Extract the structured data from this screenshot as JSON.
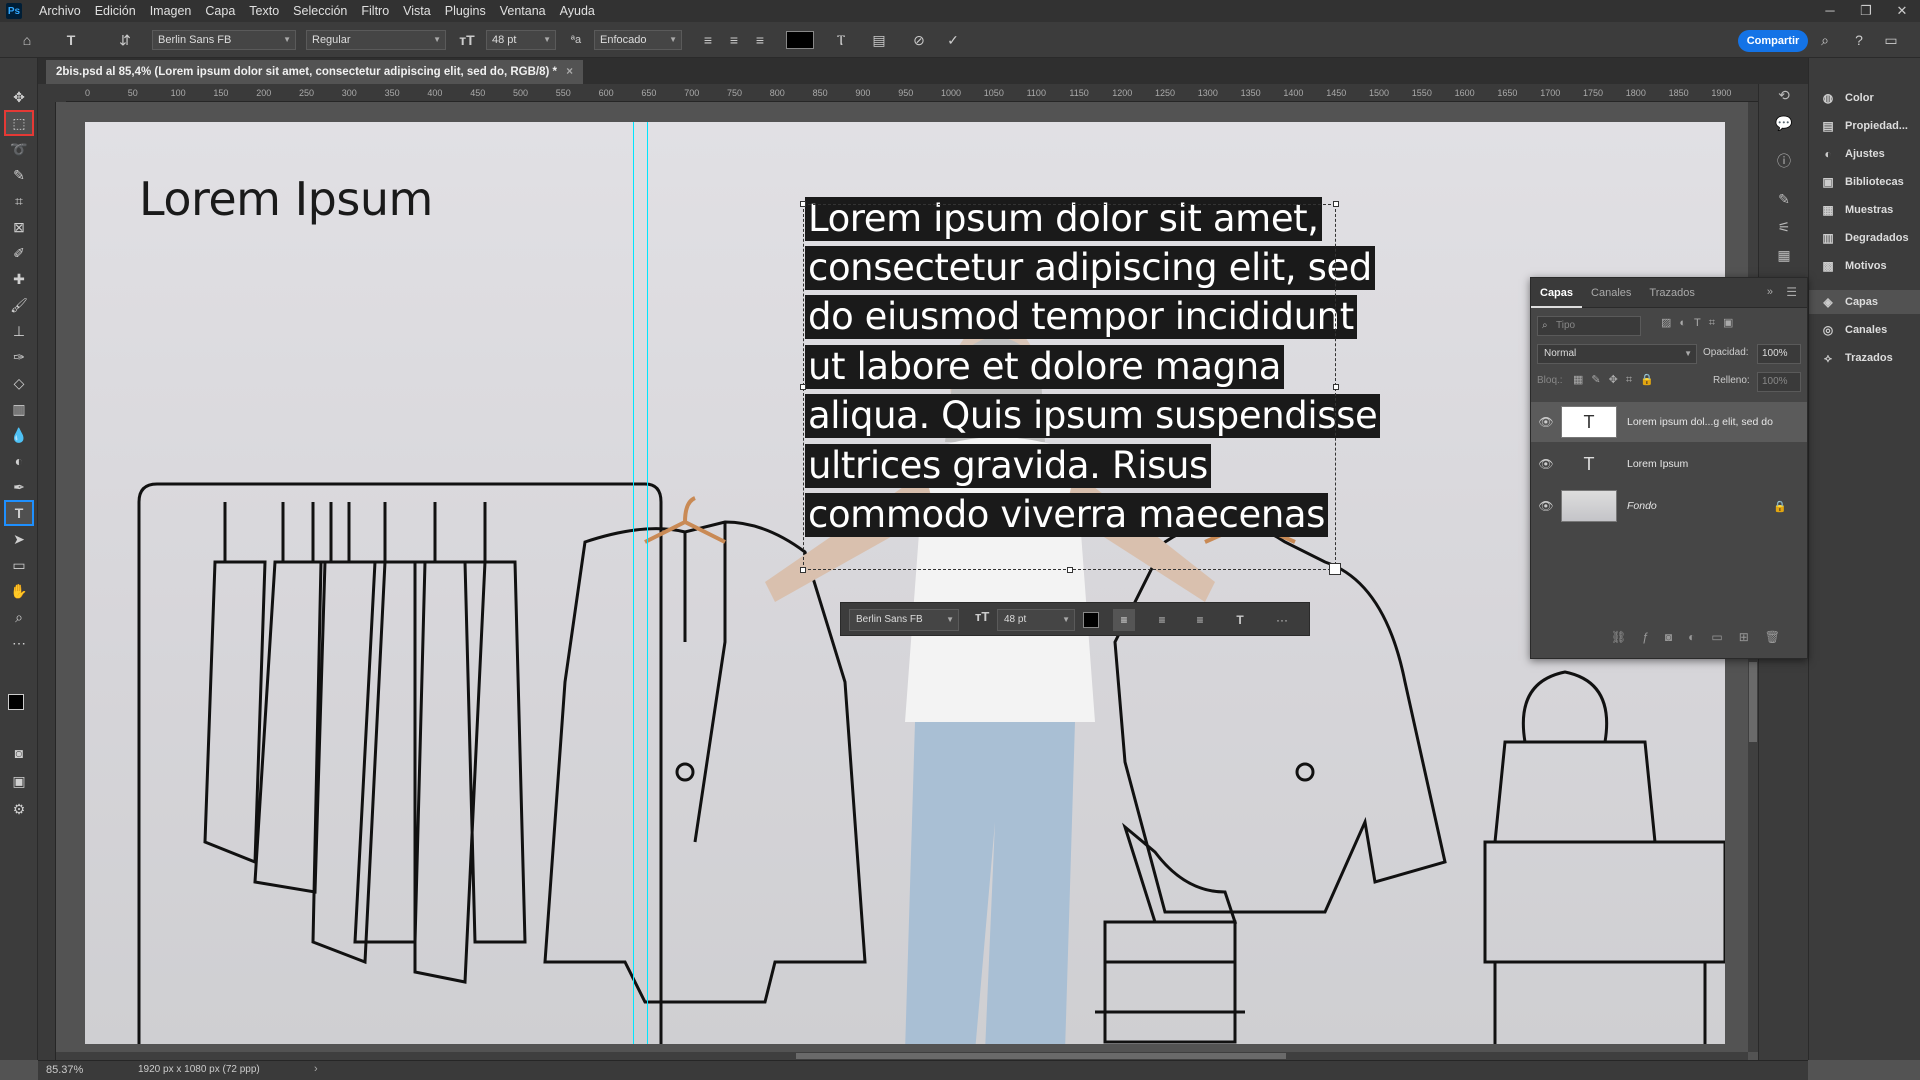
{
  "menubar": {
    "logo": "Ps",
    "items": [
      "Archivo",
      "Edición",
      "Imagen",
      "Capa",
      "Texto",
      "Selección",
      "Filtro",
      "Vista",
      "Plugins",
      "Ventana",
      "Ayuda"
    ]
  },
  "options": {
    "font_family": "Berlin Sans FB",
    "font_style": "Regular",
    "font_size": "48 pt",
    "antialias": "Enfocado",
    "text_color": "#000000",
    "share_label": "Compartir"
  },
  "document": {
    "tab_title": "2bis.psd al 85,4% (Lorem ipsum dolor sit amet, consectetur adipiscing elit, sed do, RGB/8) *",
    "close": "×"
  },
  "ruler": {
    "ticks": [
      "0",
      "50",
      "100",
      "150",
      "200",
      "250",
      "300",
      "350",
      "400",
      "450",
      "500",
      "550",
      "600",
      "650",
      "700",
      "750",
      "800",
      "850",
      "900",
      "950",
      "1000",
      "1050",
      "1100",
      "1150",
      "1200",
      "1250",
      "1300",
      "1350",
      "1400",
      "1450",
      "1500",
      "1550",
      "1600",
      "1650",
      "1700",
      "1750",
      "1800",
      "1850",
      "1900"
    ]
  },
  "canvas": {
    "title": "Lorem Ipsum",
    "paragraph_lines": [
      "Lorem ipsum dolor sit amet,",
      "consectetur adipiscing elit, sed",
      "do eiusmod tempor incididunt",
      "ut labore et dolore magna",
      "aliqua. Quis ipsum suspendisse",
      "ultrices gravida. Risus",
      "commodo viverra maecenas"
    ]
  },
  "float_bar": {
    "font_family": "Berlin Sans FB",
    "font_size": "48 pt",
    "more": "···"
  },
  "right_panel": {
    "items": [
      "Color",
      "Propiedad...",
      "Ajustes",
      "Bibliotecas",
      "Muestras",
      "Degradados",
      "Motivos",
      "Capas",
      "Canales",
      "Trazados"
    ]
  },
  "layers": {
    "tabs": [
      "Capas",
      "Canales",
      "Trazados"
    ],
    "search_placeholder": "Tipo",
    "blend_mode": "Normal",
    "opacity_label": "Opacidad:",
    "opacity_value": "100%",
    "lock_label": "Bloq.:",
    "fill_label": "Relleno:",
    "fill_value": "100%",
    "rows": [
      {
        "name": "Lorem ipsum dol...g elit, sed do",
        "thumb": "T"
      },
      {
        "name": "Lorem Ipsum",
        "thumb": "T"
      },
      {
        "name": "Fondo",
        "thumb": ""
      }
    ]
  },
  "status": {
    "zoom": "85.37%",
    "doc_info": "1920 px x 1080 px (72 ppp)"
  }
}
